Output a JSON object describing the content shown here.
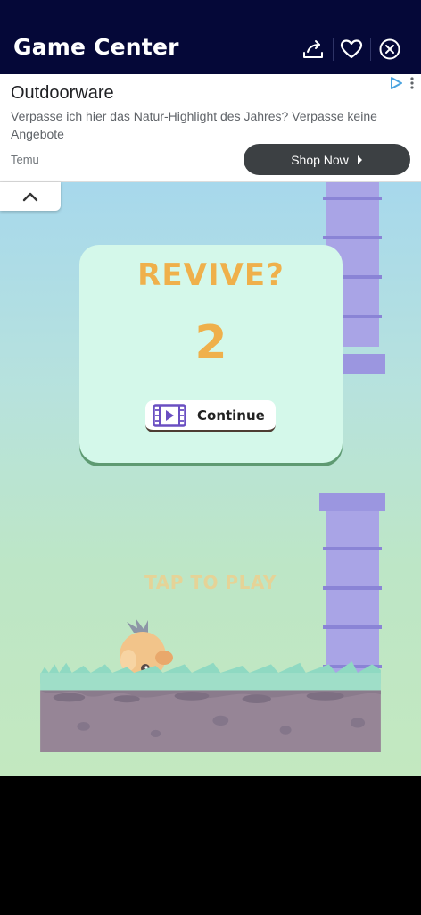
{
  "header": {
    "title": "Game Center",
    "icons": [
      "share-icon",
      "heart-icon",
      "close-icon"
    ]
  },
  "ad": {
    "title": "Outdoorware",
    "description": "Verpasse ich hier das Natur-Highlight des Jahres? Verpasse keine Angebote",
    "brand": "Temu",
    "cta_label": "Shop Now",
    "cta_icon": "chevron-right-icon"
  },
  "game": {
    "revive_title": "REVIVE?",
    "countdown": "2",
    "continue_label": "Continue",
    "tap_to_play": "TAP TO PLAY"
  },
  "colors": {
    "header_bg": "#050838",
    "accent_orange": "#efb04b",
    "pipe": "#a9a4e6",
    "panel": "#d4f8ea"
  }
}
